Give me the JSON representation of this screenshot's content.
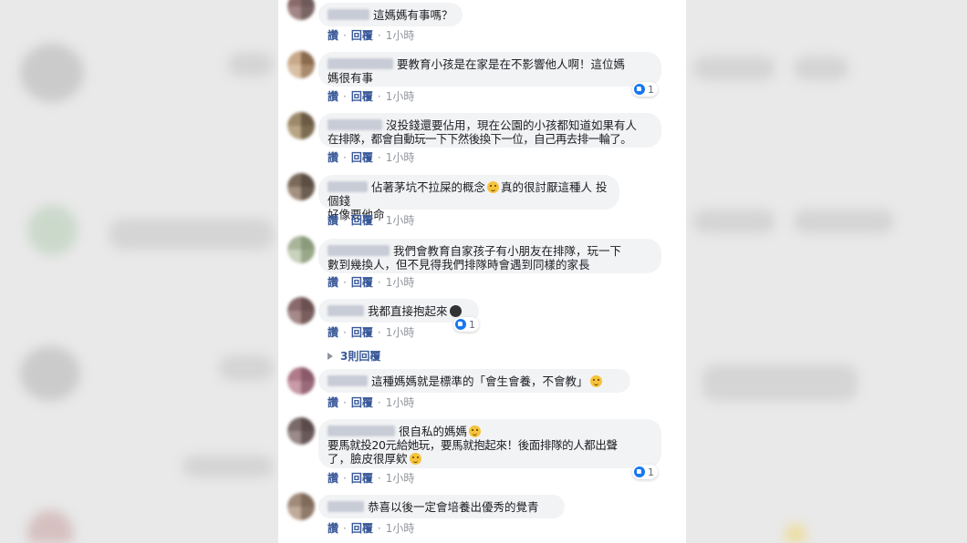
{
  "ui": {
    "like_label": "讚",
    "reply_label": "回覆",
    "separator": "·",
    "time": "1小時"
  },
  "comments": [
    {
      "text": "這媽媽有事嗎？",
      "lines": [
        "這媽媽有事嗎？"
      ],
      "reactions": null
    },
    {
      "text": "要教育小孩是在家是在不影響他人啊！這位媽媽很有事",
      "lines": [
        "要教育小孩是在家是在不影響他人啊！這位媽",
        "媽很有事"
      ],
      "reactions": "1"
    },
    {
      "text": "沒投錢還要佔用，現在公園的小孩都知道如果有人在排隊，都會自動玩一下下然後換下一位，自己再去排一輪了。",
      "lines": [
        "沒投錢還要佔用，現在公園的小孩都知道如果有人",
        "在排隊，都會自動玩一下下然後換下一位，自己再去排一輪了。"
      ],
      "reactions": null
    },
    {
      "text": "佔著茅坑不拉屎的概念😒真的很討厭這種人 投個錢好像要他命",
      "lines": [
        "佔著茅坑不拉屎的概念",
        "真的很討厭這種人 投個錢",
        "好像要他命"
      ],
      "reactions": null
    },
    {
      "text": "我們會教育自家孩子有小朋友在排隊，玩一下數到幾換人，但不見得我們排隊時會遇到同樣的家長",
      "lines": [
        "我們會教育自家孩子有小朋友在排隊，玩一下",
        "數到幾換人，但不見得我們排隊時會遇到同樣的家長"
      ],
      "reactions": null
    },
    {
      "text": "我都直接抱起來",
      "lines": [
        "我都直接抱起來"
      ],
      "reactions": "1"
    },
    {
      "text": "這種媽媽就是標準的「會生會養，不會教」",
      "lines": [
        "這種媽媽就是標準的「會生會養，不會教」"
      ],
      "reactions": null
    },
    {
      "text": "很自私的媽媽😒 要馬就投20元給她玩，要馬就抱起來！後面排隊的人都出聲了，臉皮很厚欸",
      "lines": [
        "很自私的媽媽",
        "要馬就投20元給她玩，要馬就抱起來！後面排隊的人都出聲",
        "了，臉皮很厚欸"
      ],
      "reactions": "1"
    },
    {
      "text": "恭喜以後一定會培養出優秀的覺青",
      "lines": [
        "恭喜以後一定會培養出優秀的覺青"
      ],
      "reactions": null
    }
  ],
  "view_replies": "3則回覆",
  "colors": {
    "link": "#385898",
    "bubble": "#f2f3f5",
    "like": "#1877f2"
  },
  "icons": [
    "like-reaction-icon",
    "reply-arrow-icon",
    "emoji-icon"
  ]
}
